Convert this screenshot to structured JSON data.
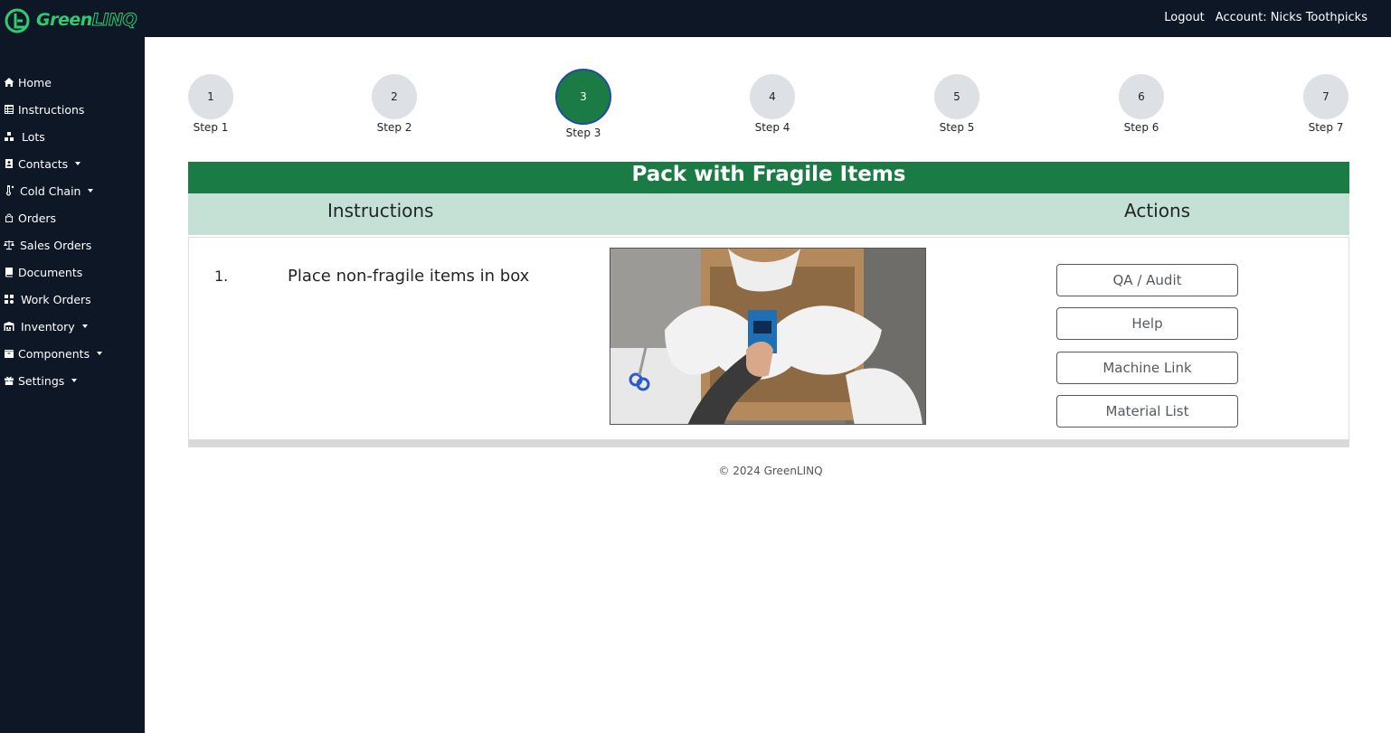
{
  "app": {
    "logo_prefix": "Green",
    "logo_suffix": "LINQ",
    "brand_color": "#2ecc71",
    "sidebar_color": "#0e1726",
    "accent_color": "#1a7b45"
  },
  "topbar": {
    "logout_label": "Logout",
    "account_label": "Account: Nicks Toothpicks"
  },
  "sidebar": {
    "items": [
      {
        "label": "Home",
        "icon": "home-icon"
      },
      {
        "label": "Instructions",
        "icon": "table-icon"
      },
      {
        "label": "Lots",
        "icon": "cubes-icon"
      },
      {
        "label": "Contacts",
        "icon": "address-book-icon",
        "dropdown": true
      },
      {
        "label": "Cold Chain",
        "icon": "thermometer-icon",
        "dropdown": true
      },
      {
        "label": "Orders",
        "icon": "shopping-bag-icon"
      },
      {
        "label": "Sales Orders",
        "icon": "balance-scale-icon"
      },
      {
        "label": "Documents",
        "icon": "book-icon"
      },
      {
        "label": "Work Orders",
        "icon": "users-cog-icon"
      },
      {
        "label": "Inventory",
        "icon": "warehouse-icon",
        "dropdown": true
      },
      {
        "label": "Components",
        "icon": "box-icon",
        "dropdown": true
      },
      {
        "label": "Settings",
        "icon": "gift-icon",
        "dropdown": true
      }
    ]
  },
  "steps": [
    {
      "number": "1",
      "label": "Step 1"
    },
    {
      "number": "2",
      "label": "Step 2"
    },
    {
      "number": "3",
      "label": "Step 3",
      "active": true
    },
    {
      "number": "4",
      "label": "Step 4"
    },
    {
      "number": "5",
      "label": "Step 5"
    },
    {
      "number": "6",
      "label": "Step 6"
    },
    {
      "number": "7",
      "label": "Step 7"
    }
  ],
  "main": {
    "title": "Pack with Fragile Items",
    "instructions_header": "Instructions",
    "actions_header": "Actions",
    "rows": [
      {
        "number": "1.",
        "text": "Place non-fragile items in box"
      }
    ],
    "actions": {
      "qa_audit": "QA / Audit",
      "help": "Help",
      "machine_link": "Machine Link",
      "material_list": "Material List"
    }
  },
  "footer": {
    "copyright": "© 2024 GreenLINQ"
  }
}
